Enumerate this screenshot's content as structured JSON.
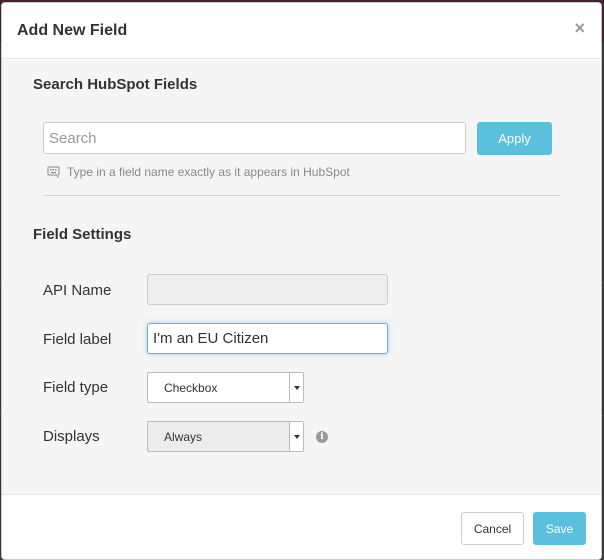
{
  "modal": {
    "title": "Add New Field",
    "close_label": "×"
  },
  "search_section": {
    "title": "Search HubSpot Fields",
    "search_placeholder": "Search",
    "search_value": "",
    "apply_label": "Apply",
    "hint_icon": "keyboard-icon",
    "hint": "Type in a field name exactly as it appears in HubSpot"
  },
  "settings_section": {
    "title": "Field Settings",
    "api_name_label": "API Name",
    "api_name_value": "",
    "field_label_label": "Field label",
    "field_label_value": "I'm an EU Citizen",
    "field_type_label": "Field type",
    "field_type_value": "Checkbox",
    "displays_label": "Displays",
    "displays_value": "Always",
    "info_icon": "info-icon"
  },
  "footer": {
    "cancel_label": "Cancel",
    "save_label": "Save"
  },
  "colors": {
    "accent": "#5bc0de",
    "focus": "#66afe9"
  }
}
